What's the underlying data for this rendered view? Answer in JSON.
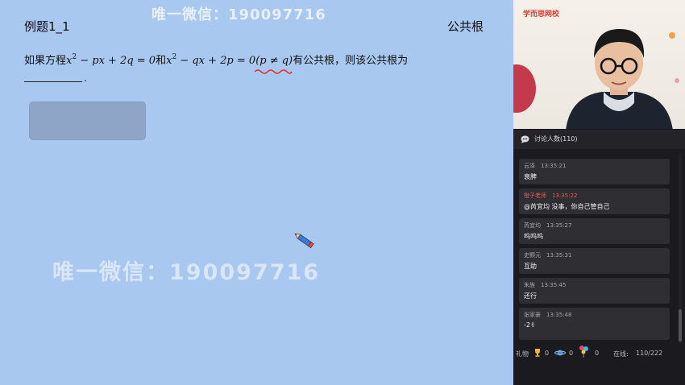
{
  "board": {
    "example_title": "例题1_1",
    "topic_tag": "公共根",
    "watermark_top": "唯一微信：190097716",
    "watermark_mid": "唯一微信：190097716",
    "problem": {
      "p1": "如果方程",
      "m1": "x",
      "m1_sup": "2",
      "m2": " − px + 2q = 0",
      "p2": "和",
      "m3": "x",
      "m3_sup": "2",
      "m4": " − qx + 2p = 0",
      "m5": "(p ≠ q)",
      "p3": "有公共根，则该公共根为"
    },
    "blank_end": "."
  },
  "video": {
    "brand": "学而思网校"
  },
  "chat": {
    "header": "讨论人数(110)",
    "messages": [
      {
        "name": "云泽",
        "time": "13:35:21",
        "text": "衰脾"
      },
      {
        "name": "橙子老师",
        "time": "13:35:22",
        "text": "@芮宜均 没事，你自己管自己"
      },
      {
        "name": "芮宜均",
        "time": "13:35:27",
        "text": "呜呜呜"
      },
      {
        "name": "史颢元",
        "time": "13:35:31",
        "text": "互助"
      },
      {
        "name": "朱旌",
        "time": "13:35:45",
        "text": "还行"
      },
      {
        "name": "张家豪",
        "time": "13:35:48",
        "text": "-2✌"
      }
    ]
  },
  "gifts": {
    "label": "礼物",
    "count1": "0",
    "count2": "0",
    "count3": "0",
    "online_label": "在线:",
    "online_value": "110/222"
  },
  "colors": {
    "board_bg": "#a9c8ef",
    "sidebar_bg": "#1b1b1f",
    "teacher_name": "#e85a50",
    "brand_red": "#e23b2e"
  }
}
